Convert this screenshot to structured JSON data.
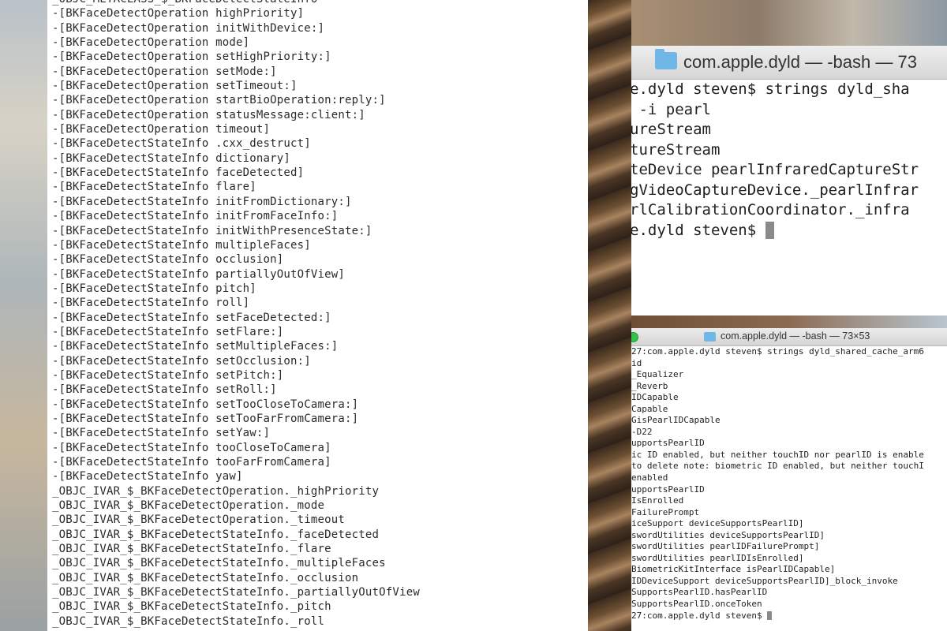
{
  "left_document": {
    "lines": [
      "_OBJC_METACLASS_$_BKFaceDetectStateInfo",
      "-[BKFaceDetectOperation highPriority]",
      "-[BKFaceDetectOperation initWithDevice:]",
      "-[BKFaceDetectOperation mode]",
      "-[BKFaceDetectOperation setHighPriority:]",
      "-[BKFaceDetectOperation setMode:]",
      "-[BKFaceDetectOperation setTimeout:]",
      "-[BKFaceDetectOperation startBioOperation:reply:]",
      "-[BKFaceDetectOperation statusMessage:client:]",
      "-[BKFaceDetectOperation timeout]",
      "-[BKFaceDetectStateInfo .cxx_destruct]",
      "-[BKFaceDetectStateInfo dictionary]",
      "-[BKFaceDetectStateInfo faceDetected]",
      "-[BKFaceDetectStateInfo flare]",
      "-[BKFaceDetectStateInfo initFromDictionary:]",
      "-[BKFaceDetectStateInfo initFromFaceInfo:]",
      "-[BKFaceDetectStateInfo initWithPresenceState:]",
      "-[BKFaceDetectStateInfo multipleFaces]",
      "-[BKFaceDetectStateInfo occlusion]",
      "-[BKFaceDetectStateInfo partiallyOutOfView]",
      "-[BKFaceDetectStateInfo pitch]",
      "-[BKFaceDetectStateInfo roll]",
      "-[BKFaceDetectStateInfo setFaceDetected:]",
      "-[BKFaceDetectStateInfo setFlare:]",
      "-[BKFaceDetectStateInfo setMultipleFaces:]",
      "-[BKFaceDetectStateInfo setOcclusion:]",
      "-[BKFaceDetectStateInfo setPitch:]",
      "-[BKFaceDetectStateInfo setRoll:]",
      "-[BKFaceDetectStateInfo setTooCloseToCamera:]",
      "-[BKFaceDetectStateInfo setTooFarFromCamera:]",
      "-[BKFaceDetectStateInfo setYaw:]",
      "-[BKFaceDetectStateInfo tooCloseToCamera]",
      "-[BKFaceDetectStateInfo tooFarFromCamera]",
      "-[BKFaceDetectStateInfo yaw]",
      "_OBJC_IVAR_$_BKFaceDetectOperation._highPriority",
      "_OBJC_IVAR_$_BKFaceDetectOperation._mode",
      "_OBJC_IVAR_$_BKFaceDetectOperation._timeout",
      "_OBJC_IVAR_$_BKFaceDetectStateInfo._faceDetected",
      "_OBJC_IVAR_$_BKFaceDetectStateInfo._flare",
      "_OBJC_IVAR_$_BKFaceDetectStateInfo._multipleFaces",
      "_OBJC_IVAR_$_BKFaceDetectStateInfo._occlusion",
      "_OBJC_IVAR_$_BKFaceDetectStateInfo._partiallyOutOfView",
      "_OBJC_IVAR_$_BKFaceDetectStateInfo._pitch",
      "_OBJC_IVAR_$_BKFaceDetectStateInfo._roll"
    ]
  },
  "terminal_top": {
    "title": "com.apple.dyld — -bash — 73",
    "lines": [
      "e.dyld steven$ strings dyld_sha",
      " -i pearl",
      "ureStream",
      "tureStream",
      "teDevice pearlInfraredCaptureStr",
      "gVideoCaptureDevice._pearlInfrar",
      "rlCalibrationCoordinator._infra",
      "e.dyld steven$ "
    ]
  },
  "terminal_bottom": {
    "title": "com.apple.dyld — -bash — 73×53",
    "lines": [
      "27:com.apple.dyld steven$ strings dyld_shared_cache_arm6",
      "id",
      "_Equalizer",
      "_Reverb",
      "IDCapable",
      "Capable",
      "GisPearlIDCapable",
      "-D22",
      "upportsPearlID",
      "ic ID enabled, but neither touchID nor pearlID is enable",
      "to delete note: biometric ID enabled, but neither touchI",
      "enabled",
      "upportsPearlID",
      "IsEnrolled",
      "FailurePrompt",
      "iceSupport deviceSupportsPearlID]",
      "swordUtilities deviceSupportsPearlID]",
      "swordUtilities pearlIDFailurePrompt]",
      "swordUtilities pearlIDIsEnrolled]",
      "BiometricKitInterface isPearlIDCapable]",
      "IDDeviceSupport deviceSupportsPearlID]_block_invoke",
      "SupportsPearlID.hasPearlID",
      "SupportsPearlID.onceToken",
      "27:com.apple.dyld steven$ "
    ]
  },
  "icons": {
    "folder": "folder-icon",
    "window_zoom": "green-zoom-button",
    "cursor": "terminal-cursor"
  },
  "colors": {
    "folder_blue": "#6fb7e6",
    "zoom_green": "#35c14a",
    "cursor_gray": "#8a8a8a"
  }
}
